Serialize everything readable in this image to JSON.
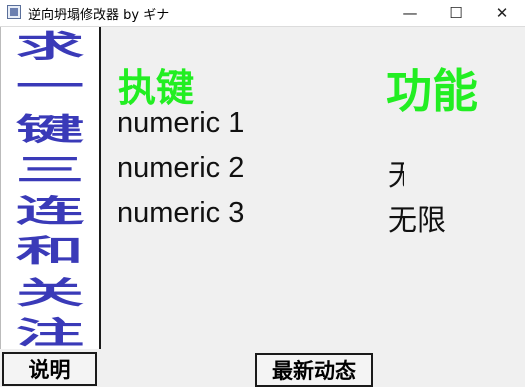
{
  "window": {
    "title": "逆向坍塌修改器 by ギナ",
    "minimize_icon": "minimize-icon",
    "maximize_icon": "maximize-icon",
    "close_icon": "close-icon"
  },
  "sidebar": {
    "chars": [
      "求",
      "一",
      "键",
      "三",
      "连",
      "和",
      "关",
      "注"
    ]
  },
  "table": {
    "hotkey_header": "执键",
    "function_header": "功能",
    "rows": [
      {
        "key": "numeric 1",
        "function": ""
      },
      {
        "key": "numeric 2",
        "function": "无"
      },
      {
        "key": "numeric 3",
        "function": "无限"
      }
    ]
  },
  "buttons": {
    "help": "说明",
    "news": "最新动态"
  },
  "colors": {
    "header_green": "#22ee22",
    "sidebar_blue": "#3a3ab8"
  }
}
